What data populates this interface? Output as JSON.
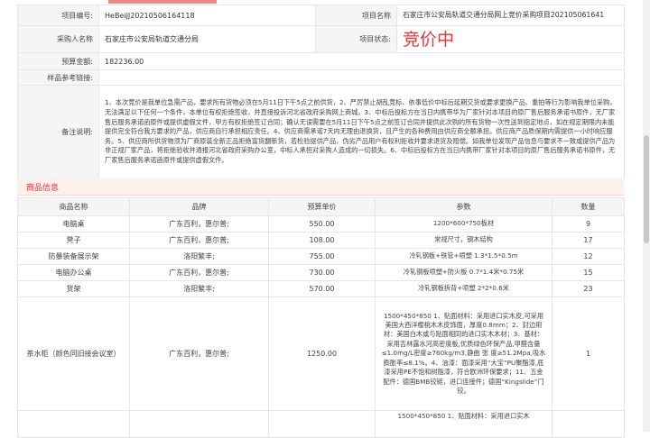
{
  "info": {
    "project_no_label": "项目编号:",
    "project_no": "HeBeiJJ20210506164118",
    "project_name_label": "项目名称",
    "project_name": "石家庄市公安局轨道交通分局网上竞价采购项目202105061641",
    "buyer_label": "采购人名称",
    "buyer": "石家庄市公安局轨道交通分局",
    "status_label": "项目状态:",
    "status": "竞价中",
    "budget_label": "预算金额:",
    "budget": "182236.00",
    "sample_link_label": "样品参考链接:",
    "sample_link": "",
    "remarks_label": "备注说明:",
    "remarks": "1、本次竞价是我单位急需产品，要求所有货物必须在5月11日下午5点之前供货，2、严厉禁止胡乱竞标、依事低价中标后延期交货或要求更换产品、重拍等行为影响我单位采购，无法满足以下任何一个条件，本单位有权拒绝签收，并直接投诉河北省政府采购网上商城。3、中标后投标方在当日内携带华为厂家针对本项目的原厂售后服务承诺书原件，无厂家售后服务承诺函原件或提供虚假文件，甲方有权拒绝签订合同；确认无误需要在5月11日下午5点之前签订合同并提供此次购的所有货物一次性送到指定地点，如在规定期限内未能提供完全符合我方要求的产品，供应商自行承担相应责任。4、供应商需承诺7天内无理由退换货，且产生的各种费用由供应商全额承担。供应商产品质保期内需提供一小时响应服务。5、供应商所供货物须为厂商原装全新正品拒绝富货翻新货，若检验提供产品，伪劣产品用户有权利拒收并要求退货及赔偿。如我单位发现产品信息与要求不一致或提供产品为非正规厂家产品，将拒绝验收并通报河北省政府采购办公室，中标人承担对采购人造成的一切损失。6、中标后投标方在当日内携带厂家针对本项目的原厂售后服务承诺书原件，无厂家售后服务承诺函原件或提供虚假文件。"
  },
  "section_title": "商品信息",
  "products": {
    "headers": [
      "商品名称",
      "品牌",
      "预算单价",
      "参数",
      "数量"
    ],
    "rows": [
      {
        "name": "电脑桌",
        "brand": "广东百利，惠尔普;",
        "price": "550.00",
        "params": "1200*600*750板材",
        "qty": "9"
      },
      {
        "name": "凳子",
        "brand": "广东百利，惠尔普;",
        "price": "108.00",
        "params": "常规尺寸，钢木结构",
        "qty": "17"
      },
      {
        "name": "防暴装备展示架",
        "brand": "洛阳繁丰;",
        "price": "755.00",
        "params": "冷轧钢板+铁管+喷塑 1.3*1.5*0.5m",
        "qty": "12"
      },
      {
        "name": "电脑办公桌",
        "brand": "广东百利，惠尔普;",
        "price": "730.00",
        "params": "冷轧钢板喷塑+防火板 0.7*1.4米*0.75米",
        "qty": "15"
      },
      {
        "name": "货架",
        "brand": "洛阳繁丰;",
        "price": "570.00",
        "params": "冷轧钢板拆背+喷塑 2*2*0.6米",
        "qty": "23"
      },
      {
        "name": "茶水柜（颜色同旧接会议室）",
        "brand": "广东百利，惠尔普;",
        "price": "1250.00",
        "params": "1500*450*850 1、贴面材料：采用进口实木皮,可采用美国大西洋樱桃木木皮饰面，厚度0.8mm；2、封边用材：美国白木或与贴面相同的进口实木木材；3、基材：采用吉林露水河高密度板,优质绿色环保产品,甲醛含量≤1.0mg/L密度≥760kg/m3,静曲 张 度≥51.2Mpa,吸水膨胀率≤8.1%。4、油漆：面漆采用“大宝”PU聚酯漆,底漆采用PE不饱和树脂漆，符合欧洲环保要求；11、五金配件：德国BMB铰链，进口连接件；德国“Kingslide”门铰。",
        "qty": "1"
      },
      {
        "name": "",
        "brand": "",
        "price": "",
        "params": "1500*450*850 1、贴面材料：采用进口实木",
        "qty": ""
      }
    ]
  }
}
